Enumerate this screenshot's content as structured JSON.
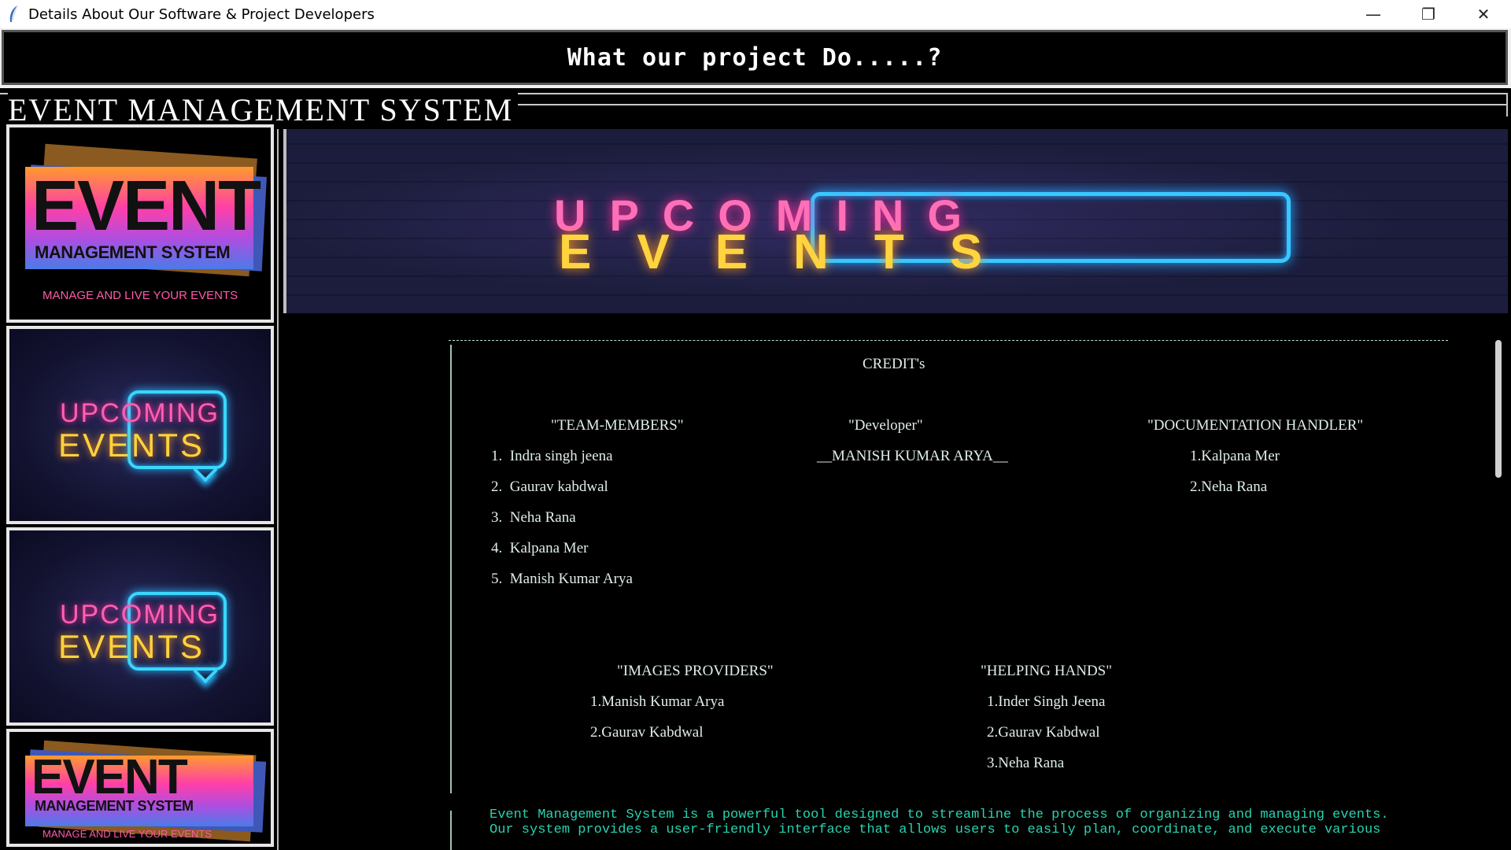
{
  "window": {
    "title": "Details About Our Software & Project Developers",
    "controls": {
      "minimize": "—",
      "restore": "❐",
      "close": "✕"
    }
  },
  "header": {
    "text": "What our project Do.....?"
  },
  "app_heading": "EVENT MANAGEMENT SYSTEM",
  "thumbnails": {
    "logo": {
      "big": "EVENT",
      "small": "MANAGEMENT SYSTEM",
      "tagline": "MANAGE AND LIVE YOUR EVENTS"
    },
    "neon": {
      "line1": "UPCOMING",
      "line2": "EVENTS"
    }
  },
  "banner": {
    "line1": "UPCOMING",
    "line2": "EVENTS"
  },
  "credits": {
    "title": "CREDIT's",
    "team_members": {
      "heading": "\"TEAM-MEMBERS\"",
      "items": [
        "1.  Indra singh jeena",
        "2.  Gaurav kabdwal",
        "3.  Neha Rana",
        "4.  Kalpana Mer",
        "5.  Manish Kumar Arya"
      ]
    },
    "developer": {
      "heading": "\"Developer\"",
      "name": "__MANISH KUMAR ARYA__"
    },
    "documentation": {
      "heading": "\"DOCUMENTATION HANDLER\"",
      "items": [
        "1.Kalpana Mer",
        "2.Neha Rana"
      ]
    },
    "images_providers": {
      "heading": "\"IMAGES PROVIDERS\"",
      "items": [
        "1.Manish Kumar Arya",
        "2.Gaurav Kabdwal"
      ]
    },
    "helping_hands": {
      "heading": "\"HELPING HANDS\"",
      "items": [
        "1.Inder Singh Jeena",
        "2.Gaurav Kabdwal",
        "3.Neha Rana"
      ]
    }
  },
  "description": {
    "line1": "Event Management System is a powerful tool designed to streamline the process of organizing and managing events.",
    "line2": "Our system provides a user-friendly interface that allows users to easily plan, coordinate, and execute various"
  }
}
